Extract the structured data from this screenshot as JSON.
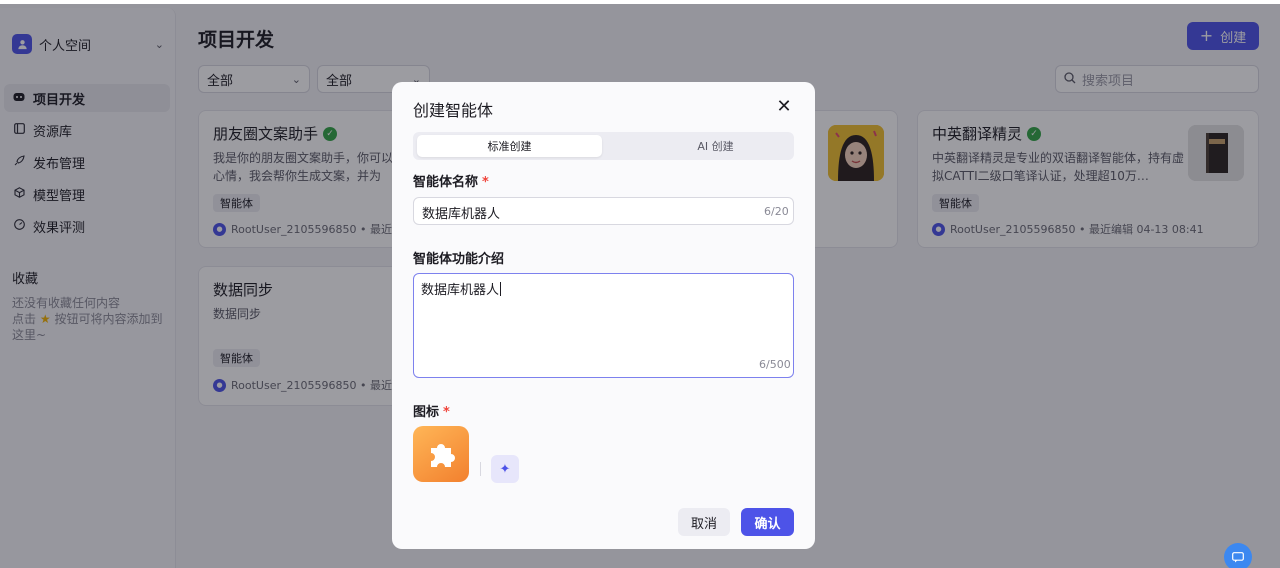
{
  "sidebar": {
    "space_label": "个人空间",
    "space_avatar_icon": "user-icon",
    "items": [
      {
        "label": "项目开发",
        "icon": "bot-icon",
        "active": true
      },
      {
        "label": "资源库",
        "icon": "library-icon"
      },
      {
        "label": "发布管理",
        "icon": "rocket-icon"
      },
      {
        "label": "模型管理",
        "icon": "cube-icon"
      },
      {
        "label": "效果评测",
        "icon": "gauge-icon"
      }
    ],
    "favorites_title": "收藏",
    "favorites_empty_line1": "还没有收藏任何内容",
    "favorites_empty_line2_pre": "点击",
    "favorites_empty_line2_post": "按钮可将内容添加到",
    "favorites_empty_line3": "这里~"
  },
  "main": {
    "title": "项目开发",
    "create_label": "创建",
    "filter1": "全部",
    "filter2": "全部",
    "search_placeholder": "搜索项目"
  },
  "cards": [
    {
      "title": "朋友圈文案助手",
      "desc": "我是你的朋友圈文案助手，你可以告诉我你的心情，我会帮你生成文案，并为",
      "tag": "智能体",
      "author": "RootUser_2105596850 • 最近编辑"
    },
    {
      "title": "中英翻译精灵",
      "desc": "中英翻译精灵是专业的双语翻译智能体，持有虚拟CATTI二级口笔译认证，处理超10万…",
      "tag": "智能体",
      "author": "RootUser_2105596850 • 最近编辑 04-13 08:41"
    },
    {
      "title": "数据同步",
      "desc": "数据同步",
      "tag": "智能体",
      "author": "RootUser_2105596850 • 最近编辑"
    }
  ],
  "modal": {
    "title": "创建智能体",
    "tab_standard": "标准创建",
    "tab_ai": "AI 创建",
    "name_label": "智能体名称",
    "name_value": "数据库机器人",
    "name_counter": "6/20",
    "desc_label": "智能体功能介绍",
    "desc_value": "数据库机器人",
    "desc_counter": "6/500",
    "icon_label": "图标",
    "required_mark": "*",
    "cancel_label": "取消",
    "confirm_label": "确认"
  },
  "colors": {
    "accent": "#4d53e8",
    "required": "#f0433a",
    "verified": "#32a645"
  }
}
